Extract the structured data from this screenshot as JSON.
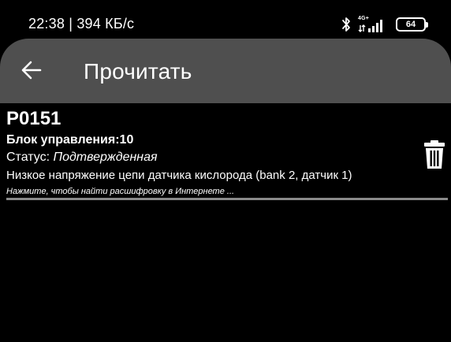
{
  "status_bar": {
    "time_speed": "22:38 | 394 КБ/с",
    "network_type": "4G+",
    "battery_level": "64"
  },
  "app_bar": {
    "title": "Прочитать",
    "back_icon": "arrow-left-icon"
  },
  "dtc": {
    "code": "P0151",
    "module": "Блок управления:10",
    "status_label": "Статус: ",
    "status_value": "Подтвержденная",
    "description": "Низкое напряжение цепи датчика кислорода (bank 2, датчик 1)",
    "hint": "Нажмите, чтобы найти расшифровку в Интернете ...",
    "delete_icon": "trash-icon"
  },
  "colors": {
    "background": "#000000",
    "app_bar": "#4f4f4f",
    "text": "#ffffff",
    "divider": "#8a8a8a"
  }
}
